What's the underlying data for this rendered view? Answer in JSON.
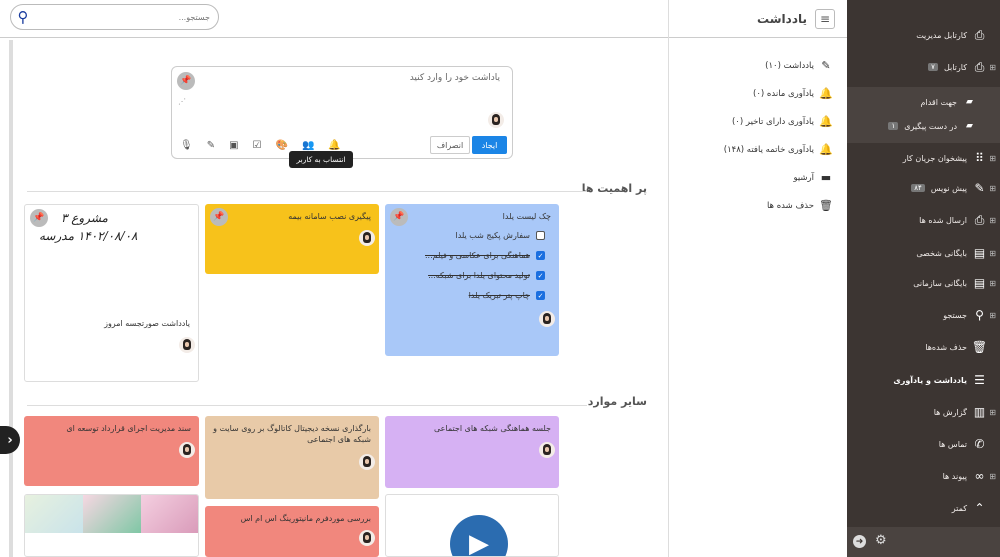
{
  "search": {
    "placeholder": "جستجو..."
  },
  "nav": {
    "title": "یادداشت",
    "items": [
      {
        "label": "یادداشت (۱۰)",
        "icon": "edit-icon"
      },
      {
        "label": "یادآوری مانده (۰)",
        "icon": "bell-icon"
      },
      {
        "label": "یادآوری دارای تاخیر (۰)",
        "icon": "bell-alert-icon"
      },
      {
        "label": "یادآوری خاتمه یافته (۱۴۸)",
        "icon": "bell-icon"
      },
      {
        "label": "آرشیو",
        "icon": "archive-icon"
      },
      {
        "label": "حذف شده ها",
        "icon": "trash-icon"
      }
    ]
  },
  "sidebar": {
    "items": [
      {
        "label": "کارتابل مدیریت",
        "icon": "inbox-icon"
      },
      {
        "label": "کارتابل",
        "badge": "۷",
        "icon": "inbox-icon"
      },
      {
        "label": "جهت اقدام",
        "icon": "folder-open-icon"
      },
      {
        "label": "در دست پیگیری",
        "badge": "۱",
        "icon": "folder-open-icon"
      },
      {
        "label": "پیشخوان جریان کار",
        "icon": "workflow-icon"
      },
      {
        "label": "پیش نویس",
        "badge": "۸۴",
        "icon": "draft-icon"
      },
      {
        "label": "ارسال شده ها",
        "icon": "send-icon"
      },
      {
        "label": "بایگانی شخصی",
        "icon": "cabinet-icon"
      },
      {
        "label": "بایگانی سازمانی",
        "icon": "cabinet-icon"
      },
      {
        "label": "جستجو",
        "icon": "search-icon"
      },
      {
        "label": "حذف شده‌ها",
        "icon": "trash-icon"
      },
      {
        "label": "یادداشت و یادآوری",
        "icon": "notes-icon"
      },
      {
        "label": "گزارش ها",
        "icon": "report-icon"
      },
      {
        "label": "تماس ها",
        "icon": "phone-icon"
      },
      {
        "label": "پیوند ها",
        "icon": "link-icon"
      },
      {
        "label": "کمتر",
        "icon": "chevron-up-icon"
      }
    ]
  },
  "composer": {
    "placeholder": "یاداشت خود را وارد کنید",
    "save_label": "ایجاد",
    "cancel_label": "انصراف",
    "tooltip": "انتساب به کاربر"
  },
  "sections": {
    "important": "پر اهمیت ها",
    "others": "سایر موارد"
  },
  "cards": {
    "checklist": {
      "title": "چک لیست یلدا",
      "color": "#a9c8f8",
      "items": [
        {
          "text": "سفارش پکیج شب یلدا",
          "checked": false
        },
        {
          "text": "هماهنگی برای عکاسی و فیلم...",
          "checked": true
        },
        {
          "text": "تولید محتوای یلدا برای شبکه...",
          "checked": true
        },
        {
          "text": "چاپ پتر تبریک یلدا",
          "checked": true
        }
      ]
    },
    "insurance": {
      "title": "پیگیری نصب سامانه بیمه",
      "color": "#f7c21b"
    },
    "image_note": {
      "title": "یادداشت صورتجسه امروز",
      "handwriting_1": "مشروع ۳",
      "handwriting_2": "۱۴۰۲/۰۸/۰۸ مدرسه"
    },
    "meeting": {
      "title": "جلسه هماهنگی شبکه های اجتماعی",
      "color": "#d6b1f3"
    },
    "catalog": {
      "title": "بارگذاری نسخه دیجیتال کاتالوگ بر روی سایت و شبکه های اجتماعی",
      "color": "#e8caa8"
    },
    "contract": {
      "title": "سند مدیریت اجرای قرارداد توسعه ای",
      "color": "#f1877d"
    },
    "mms": {
      "title": "بررسی موردفرم مانیتورینگ اس ام اس",
      "color": "#f1877d"
    }
  }
}
